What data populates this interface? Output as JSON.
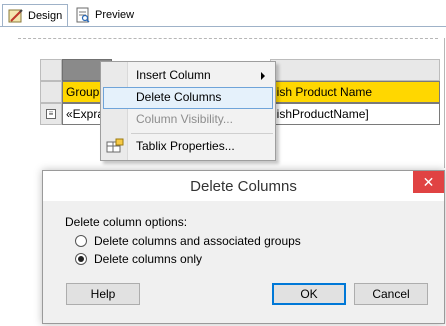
{
  "tabs": [
    {
      "label": "Design",
      "icon": "design-icon",
      "active": true
    },
    {
      "label": "Preview",
      "icon": "preview-icon",
      "active": false
    }
  ],
  "tablix": {
    "header_left": "Group",
    "header_right": "lish Product Name",
    "detail_left": "«Expra",
    "detail_right": "lishProductName]",
    "row_handle_glyph": "≡",
    "header_color": "#ffd700"
  },
  "context_menu": {
    "items": [
      {
        "label": "Insert Column",
        "has_submenu": true,
        "state": "normal"
      },
      {
        "label": "Delete Columns",
        "has_submenu": false,
        "state": "highlighted"
      },
      {
        "label": "Column Visibility...",
        "has_submenu": false,
        "state": "disabled"
      },
      {
        "label": "Tablix Properties...",
        "has_submenu": false,
        "state": "normal",
        "icon": "tablix-properties-icon"
      }
    ],
    "highlight_color": "#e5f1fb"
  },
  "dialog": {
    "title": "Delete Columns",
    "close_glyph": "✕",
    "options_label": "Delete column options:",
    "options": [
      {
        "label": "Delete columns and associated groups",
        "selected": false
      },
      {
        "label": "Delete columns only",
        "selected": true
      }
    ],
    "buttons": {
      "help": "Help",
      "ok": "OK",
      "cancel": "Cancel"
    },
    "close_color": "#e04343"
  }
}
